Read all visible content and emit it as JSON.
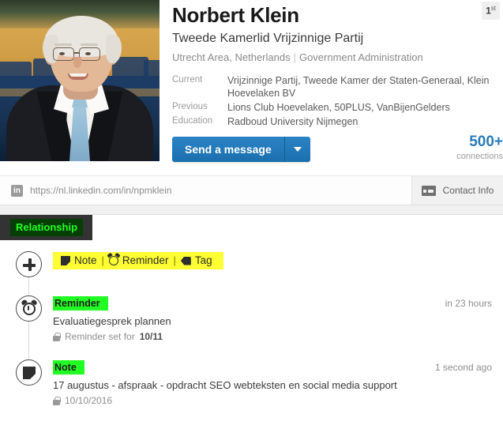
{
  "profile": {
    "photo_alt": "profile-photo",
    "full_name": "Norbert Klein",
    "headline": "Tweede Kamerlid Vrijzinnige Partij",
    "location": "Utrecht Area, Netherlands",
    "industry": "Government Administration",
    "degree_badge": "1st",
    "degree_number": "1",
    "degree_suffix": "st",
    "facts": [
      {
        "label": "Current",
        "value": "Vrijzinnige Partij, Tweede Kamer der Staten-Generaal, Klein Hoevelaken BV"
      },
      {
        "label": "Previous",
        "value": "Lions Club Hoevelaken, 50PLUS, VanBijenGelders"
      },
      {
        "label": "Education",
        "value": "Radboud University Nijmegen"
      }
    ],
    "message_button": "Send a message",
    "connections_count": "500+",
    "connections_label": "connections"
  },
  "url_bar": {
    "logo_text": "in",
    "url": "https://nl.linkedin.com/in/npmklein",
    "contact_info_label": "Contact Info"
  },
  "tabs": {
    "relationship": "Relationship"
  },
  "quick_add": {
    "note": "Note",
    "reminder": "Reminder",
    "tag": "Tag",
    "separator": "|"
  },
  "timeline": [
    {
      "icon": "alarm-clock-icon",
      "kind": "Reminder",
      "time": "in 23 hours",
      "text": "Evaluatiegesprek plannen",
      "meta_prefix": "Reminder set for",
      "meta_value": "10/11"
    },
    {
      "icon": "note-icon",
      "kind": "Note",
      "time": "1 second ago",
      "text": "17 augustus - afspraak - opdracht SEO webteksten en social media support",
      "meta_prefix": "",
      "meta_value": "10/10/2016"
    }
  ],
  "colors": {
    "accent_blue": "#2b7bb9",
    "highlight_green": "#22ff22",
    "highlight_yellow": "#ffff33",
    "tab_dark": "#333333"
  }
}
